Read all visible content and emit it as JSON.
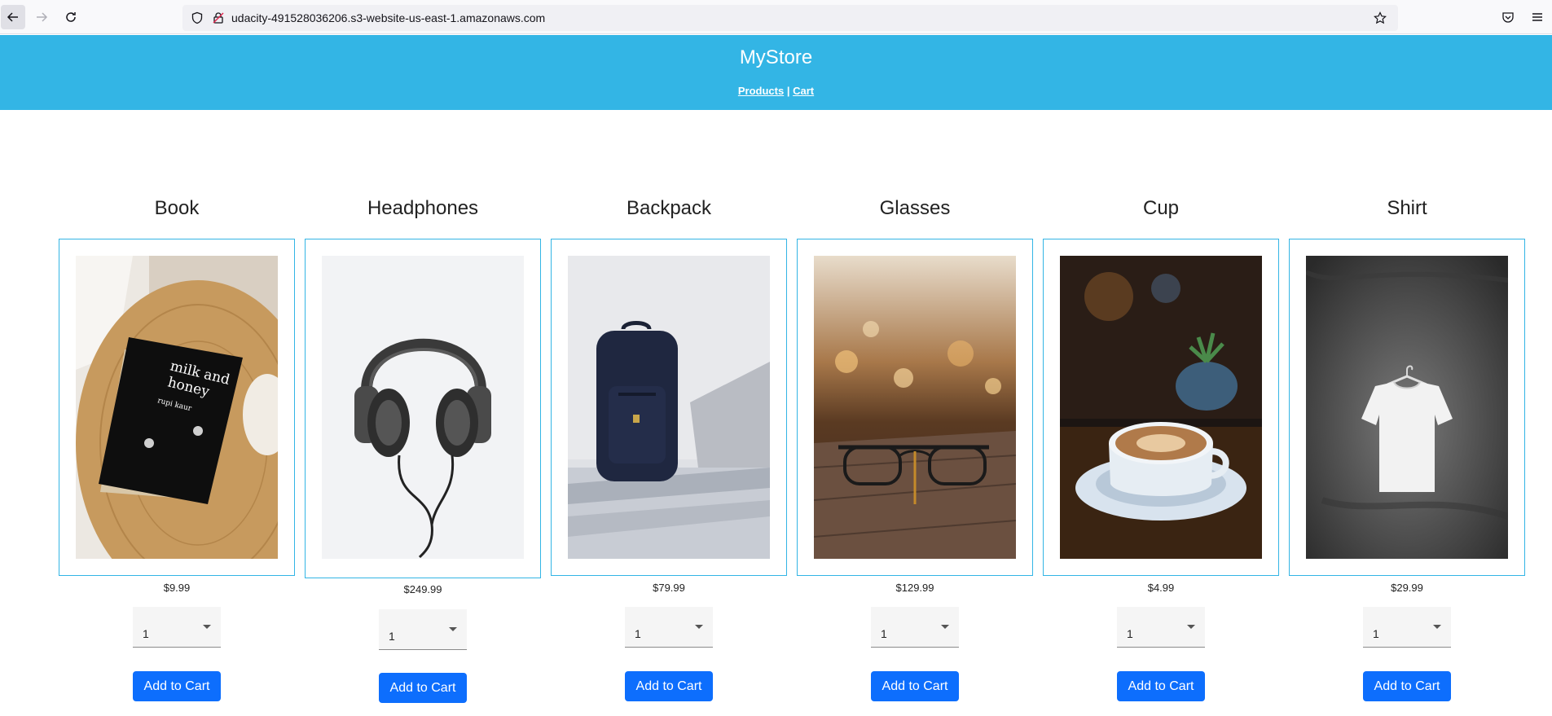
{
  "browser": {
    "url": "udacity-491528036206.s3-website-us-east-1.amazonaws.com"
  },
  "site": {
    "title": "MyStore",
    "nav": {
      "products": "Products",
      "separator": "|",
      "cart": "Cart"
    }
  },
  "products": [
    {
      "name": "Book",
      "price": "$9.99",
      "quantity": "1",
      "button": "Add to Cart"
    },
    {
      "name": "Headphones",
      "price": "$249.99",
      "quantity": "1",
      "button": "Add to Cart"
    },
    {
      "name": "Backpack",
      "price": "$79.99",
      "quantity": "1",
      "button": "Add to Cart"
    },
    {
      "name": "Glasses",
      "price": "$129.99",
      "quantity": "1",
      "button": "Add to Cart"
    },
    {
      "name": "Cup",
      "price": "$4.99",
      "quantity": "1",
      "button": "Add to Cart"
    },
    {
      "name": "Shirt",
      "price": "$29.99",
      "quantity": "1",
      "button": "Add to Cart"
    }
  ],
  "book_cover": {
    "title_line1": "milk and",
    "title_line2": "honey",
    "author": "rupi kaur"
  },
  "colors": {
    "header": "#33b5e5",
    "button": "#0d6efd",
    "frame_border": "#33b5e5"
  }
}
